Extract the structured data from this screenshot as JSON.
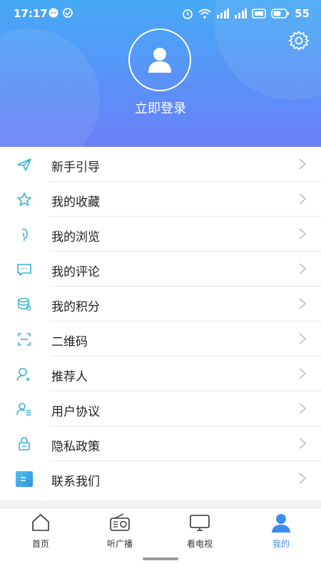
{
  "status_bar": {
    "time": "17:17",
    "battery": "55"
  },
  "profile": {
    "login_label": "立即登录"
  },
  "menu": [
    {
      "label": "新手引导",
      "icon": "send-icon"
    },
    {
      "label": "我的收藏",
      "icon": "star-icon"
    },
    {
      "label": "我的浏览",
      "icon": "footprint-icon"
    },
    {
      "label": "我的评论",
      "icon": "comment-icon"
    },
    {
      "label": "我的积分",
      "icon": "coins-icon"
    },
    {
      "label": "二维码",
      "icon": "qrcode-scan-icon"
    },
    {
      "label": "推荐人",
      "icon": "referrer-icon"
    },
    {
      "label": "用户协议",
      "icon": "user-agreement-icon"
    },
    {
      "label": "隐私政策",
      "icon": "lock-icon"
    },
    {
      "label": "联系我们",
      "icon": "contact-icon"
    }
  ],
  "tabs": [
    {
      "label": "首页",
      "icon": "home-icon"
    },
    {
      "label": "听广播",
      "icon": "radio-icon"
    },
    {
      "label": "看电视",
      "icon": "tv-icon"
    },
    {
      "label": "我的",
      "icon": "user-icon",
      "active": true
    }
  ],
  "colors": {
    "accent": "#3a8ef0",
    "header_top": "#46a9f6",
    "header_bottom": "#6b7ff6",
    "icon": "#3ab0d8"
  }
}
